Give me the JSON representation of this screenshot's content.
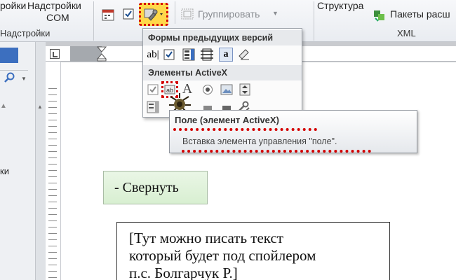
{
  "ribbon": {
    "addins_label": "ройки",
    "com_addins_label_line1": "Надстройки",
    "com_addins_label_line2": "COM",
    "group_addins": "ойки",
    "group_label_nastroyki": "Надстройки",
    "group_button": "Группировать",
    "structure_button": "Структура",
    "packages_button": "Пакеты расш",
    "group_xml": "XML"
  },
  "dropdown": {
    "legacy_header": "Формы предыдущих версий",
    "activex_header": "Элементы ActiveX",
    "legacy_text_glyph": "ab|",
    "label_glyph": "A",
    "textbox_glyph": "a"
  },
  "tooltip": {
    "title": "Поле (элемент ActiveX)",
    "description": "Вставка элемента управления \"поле\"."
  },
  "left_pane": {
    "partial_label": "ки"
  },
  "document": {
    "collapse_button": "- Свернуть",
    "spoiler_lines": [
      "[Тут можно писать текст",
      "который будет под спойлером",
      "п.с. Болгарчук Р.]"
    ]
  },
  "colors": {
    "highlight_red": "#d40000",
    "highlight_yellow": "#ffd84a",
    "collapse_bg": "#dcf0d5"
  }
}
